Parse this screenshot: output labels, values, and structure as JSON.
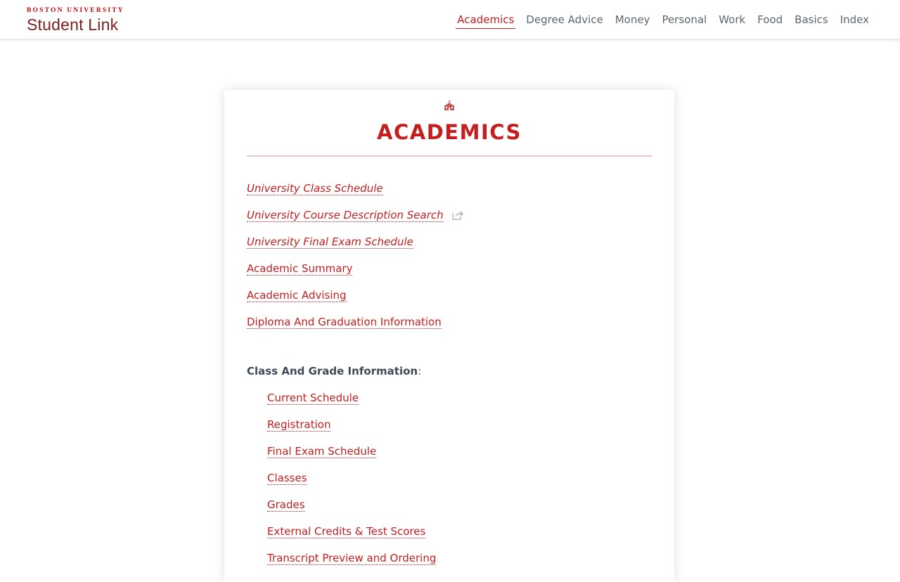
{
  "header": {
    "logo_top": "BOSTON UNIVERSITY",
    "logo_main": "Student Link",
    "nav": [
      {
        "label": "Academics",
        "active": true
      },
      {
        "label": "Degree Advice",
        "active": false
      },
      {
        "label": "Money",
        "active": false
      },
      {
        "label": "Personal",
        "active": false
      },
      {
        "label": "Work",
        "active": false
      },
      {
        "label": "Food",
        "active": false
      },
      {
        "label": "Basics",
        "active": false
      },
      {
        "label": "Index",
        "active": false
      }
    ]
  },
  "main": {
    "icon": "school-building-icon",
    "title": "ACADEMICS",
    "links": [
      {
        "label": "University Class Schedule",
        "italic": true,
        "external": false
      },
      {
        "label": "University Course Description Search",
        "italic": true,
        "external": true
      },
      {
        "label": "University Final Exam Schedule",
        "italic": true,
        "external": false
      },
      {
        "label": "Academic Summary",
        "italic": false,
        "external": false
      },
      {
        "label": "Academic Advising",
        "italic": false,
        "external": false
      },
      {
        "label": "Diploma And Graduation Information",
        "italic": false,
        "external": false
      }
    ],
    "section": {
      "label": "Class And Grade Information",
      "suffix": ":",
      "links": [
        "Current Schedule",
        "Registration",
        "Final Exam Schedule",
        "Classes",
        "Grades",
        "External Credits & Test Scores",
        "Transcript Preview and Ordering"
      ]
    }
  },
  "colors": {
    "accent": "#c41e1e",
    "text": "#3e4a57",
    "nav_text": "#5b6670",
    "rule": "#e8c6c6"
  }
}
